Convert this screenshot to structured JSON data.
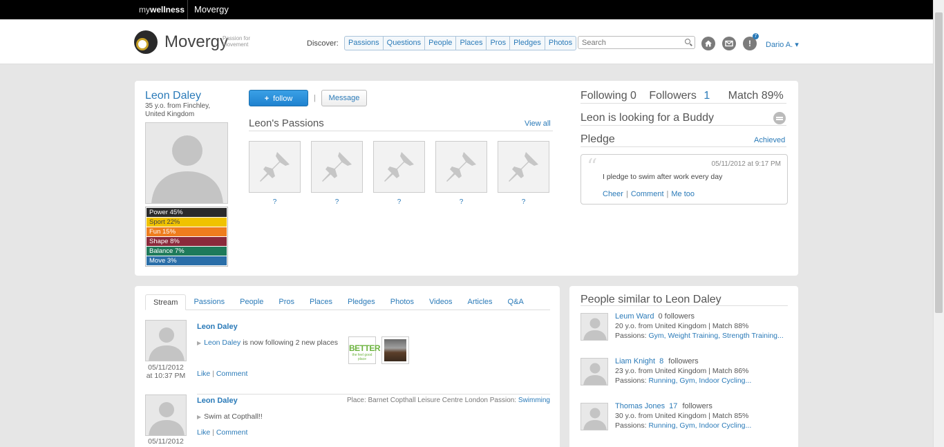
{
  "topbar": {
    "brand_light": "my",
    "brand_bold": "wellness",
    "tab": "Movergy"
  },
  "header": {
    "logo_text": "Movergy",
    "tagline_1": "Passion for",
    "tagline_2": "movement",
    "discover_label": "Discover:",
    "discover_items": [
      "Passions",
      "Questions",
      "People",
      "Places",
      "Pros",
      "Pledges",
      "Photos"
    ],
    "search_placeholder": "Search",
    "notification_count": "7",
    "user_name": "Dario A."
  },
  "profile": {
    "name": "Leon Daley",
    "subtitle": "35 y.o. from Finchley, United Kingdom",
    "stats": [
      {
        "label": "Power 45%",
        "color": "#2b2b2b"
      },
      {
        "label": "Sport 22%",
        "color": "#f0c300"
      },
      {
        "label": "Fun 15%",
        "color": "#ee7d1e"
      },
      {
        "label": "Shape 8%",
        "color": "#8a2a3b"
      },
      {
        "label": "Balance 7%",
        "color": "#1e7a5a"
      },
      {
        "label": "Move 3%",
        "color": "#2a6ea8"
      }
    ],
    "follow_label": "follow",
    "follow_plus": "+",
    "separator": "|",
    "message_label": "Message",
    "passions_title": "Leon's Passions",
    "view_all": "View all",
    "passions": [
      "?",
      "?",
      "?",
      "?",
      "?"
    ],
    "following_label": "Following 0",
    "followers_label": "Followers",
    "followers_count": "1",
    "match_label": "Match 89%",
    "buddy_text": "Leon is looking for a Buddy",
    "pledge_title": "Pledge",
    "pledge_status": "Achieved",
    "pledge": {
      "quote": "“",
      "date": "05/11/2012 at 9:17 PM",
      "text": "I pledge to swim after work every day",
      "actions": [
        "Cheer",
        "Comment",
        "Me too"
      ],
      "action_sep": "|"
    }
  },
  "stream": {
    "tabs": [
      "Stream",
      "Passions",
      "People",
      "Pros",
      "Places",
      "Pledges",
      "Photos",
      "Videos",
      "Articles",
      "Q&A"
    ],
    "posts": [
      {
        "author": "Leon Daley",
        "actor": "Leon Daley",
        "text": " is now following 2 new places",
        "date_1": "05/11/2012",
        "date_2": "at 10:37 PM",
        "like": "Like",
        "sep": "|",
        "comment": "Comment",
        "thumb_better_big": "BETTER",
        "thumb_better_small": "the feel good place"
      },
      {
        "author": "Leon Daley",
        "text": "Swim at Copthall!!",
        "meta": "Place: Barnet Copthall Leisure Centre London Passion: ",
        "meta_link": "Swimming",
        "date_1": "05/11/2012",
        "like": "Like",
        "sep": "|",
        "comment": "Comment"
      }
    ]
  },
  "similar": {
    "title": "People similar to Leon Daley",
    "people": [
      {
        "name": "Leum Ward",
        "count": "0",
        "followers": "followers",
        "info": "20 y.o. from United Kingdom |  Match 88%",
        "passions_label": "Passions: ",
        "passions": "Gym, Weight Training, Strength Training..."
      },
      {
        "name": "Liam Knight",
        "count": "8",
        "followers": "followers",
        "info": "23 y.o. from United Kingdom |  Match 86%",
        "passions_label": "Passions: ",
        "passions": "Running, Gym, Indoor Cycling..."
      },
      {
        "name": "Thomas Jones",
        "count": "17",
        "followers": "followers",
        "info": "30 y.o. from United Kingdom |  Match 85%",
        "passions_label": "Passions: ",
        "passions": "Running, Gym, Indoor Cycling..."
      }
    ]
  }
}
